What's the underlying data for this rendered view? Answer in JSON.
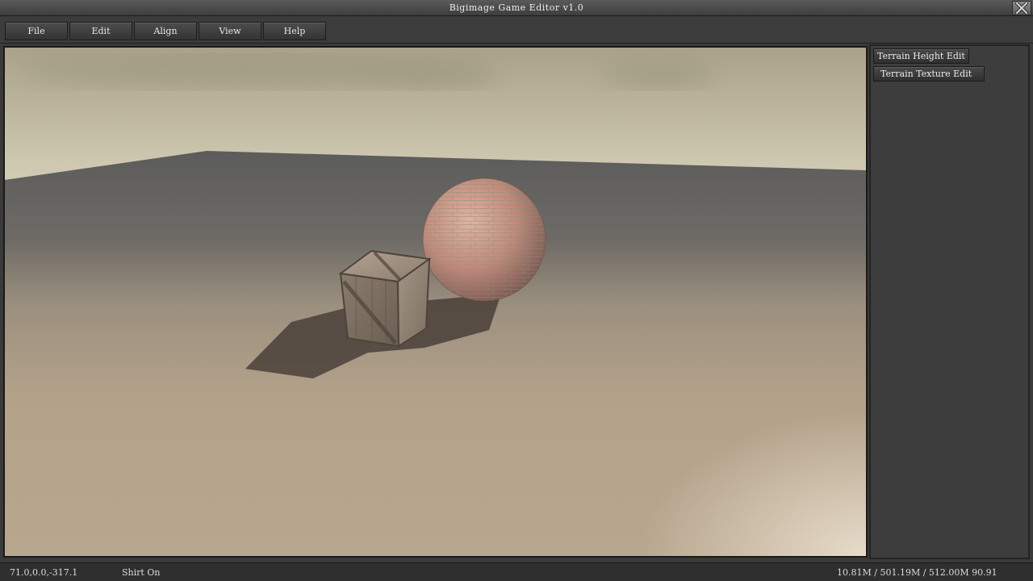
{
  "window": {
    "title": "Bigimage Game Editor v1.0",
    "close_icon": "close-x-icon"
  },
  "menu": {
    "items": [
      "File",
      "Edit",
      "Align",
      "View",
      "Help"
    ]
  },
  "panel": {
    "buttons": [
      "Terrain Height Edit",
      "Terrain Texture Edit"
    ]
  },
  "status": {
    "coordinates": "71.0,0.0,-317.1",
    "mode": "Shirt On",
    "memory": "10.81M / 501.19M / 512.00M 90.91"
  },
  "scene": {
    "objects": [
      "wooden-crate",
      "brick-sphere",
      "terrain-plane",
      "sky"
    ],
    "colors": {
      "sky_top": "#a9a288",
      "sky_bottom": "#d8d2bd",
      "terrain_far": "#5f5f5f",
      "terrain_near": "#b9a891",
      "sphere": "#c48e7c",
      "crate": "#7d6f61"
    }
  }
}
